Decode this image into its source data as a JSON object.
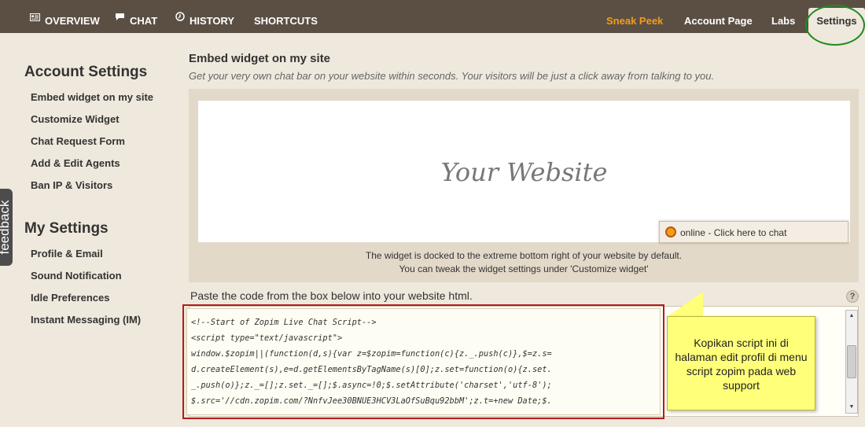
{
  "nav": {
    "overview": "OVERVIEW",
    "chat": "CHAT",
    "history": "HISTORY",
    "shortcuts": "SHORTCUTS",
    "sneak_peek": "Sneak Peek",
    "account_page": "Account Page",
    "labs": "Labs",
    "settings": "Settings"
  },
  "sidebar": {
    "account_heading": "Account Settings",
    "account_items": [
      "Embed widget on my site",
      "Customize Widget",
      "Chat Request Form",
      "Add & Edit Agents",
      "Ban IP & Visitors"
    ],
    "my_heading": "My Settings",
    "my_items": [
      "Profile & Email",
      "Sound Notification",
      "Idle Preferences",
      "Instant Messaging (IM)"
    ]
  },
  "feedback": "feedback",
  "main": {
    "title": "Embed widget on my site",
    "subtitle": "Get your very own chat bar on your website within seconds. Your visitors will be just a click away from talking to you.",
    "website_label": "Your Website",
    "chat_status": "online",
    "chat_cta": " - Click here to chat",
    "note_line1": "The widget is docked to the extreme bottom right of your website by default.",
    "note_line2": "You can tweak the widget settings under 'Customize widget'",
    "paste_label": "Paste the code from the box below into your website html.",
    "help": "?",
    "code_lines": [
      "<!--Start of Zopim Live Chat Script-->",
      "<script type=\"text/javascript\">",
      "window.$zopim||(function(d,s){var z=$zopim=function(c){z._.push(c)},$=z.s=",
      "d.createElement(s),e=d.getElementsByTagName(s)[0];z.set=function(o){z.set.",
      "_.push(o)};z._=[];z.set._=[];$.async=!0;$.setAttribute('charset','utf-8');",
      "$.src='//cdn.zopim.com/?NnfvJee30BNUE3HCV3LaOfSuBqu92bbM';z.t=+new Date;$."
    ]
  },
  "annotation": {
    "note": "Kopikan script ini di halaman edit profil di menu script zopim pada web support"
  },
  "colors": {
    "topbar": "#5b4f44",
    "accent_orange": "#f39c19",
    "annotation_red": "#b21c1c",
    "annotation_green": "#1f8b1f",
    "sticky_yellow": "#ffff7a"
  }
}
